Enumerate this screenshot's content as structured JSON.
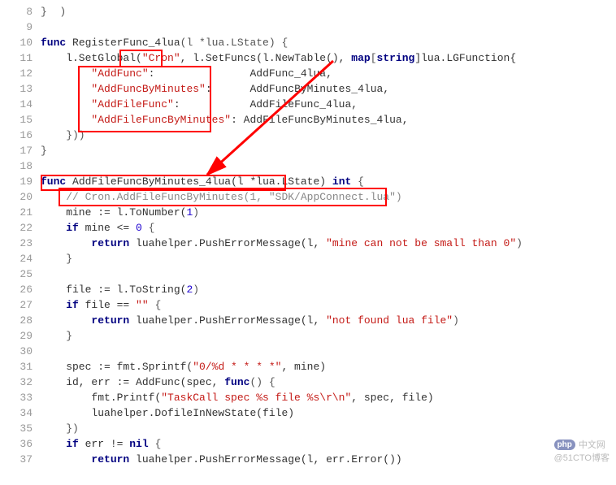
{
  "lines": [
    {
      "num": "8",
      "tokens": [
        {
          "t": "}  )",
          "c": "punct"
        }
      ]
    },
    {
      "num": "9",
      "tokens": []
    },
    {
      "num": "10",
      "tokens": [
        {
          "t": "func ",
          "c": "kw"
        },
        {
          "t": "RegisterFunc_4lua",
          "c": "func"
        },
        {
          "t": "(l *lua.LState) {",
          "c": "punct"
        }
      ]
    },
    {
      "num": "11",
      "tokens": [
        {
          "t": "    l.SetGlobal(",
          "c": "ident"
        },
        {
          "t": "\"Cron\"",
          "c": "str"
        },
        {
          "t": ", l.SetFuncs(l.NewTable(), ",
          "c": "ident"
        },
        {
          "t": "map",
          "c": "kw"
        },
        {
          "t": "[",
          "c": "punct"
        },
        {
          "t": "string",
          "c": "kw"
        },
        {
          "t": "]lua.LGFunction{",
          "c": "ident"
        }
      ]
    },
    {
      "num": "12",
      "tokens": [
        {
          "t": "        ",
          "c": ""
        },
        {
          "t": "\"AddFunc\"",
          "c": "str"
        },
        {
          "t": ":               AddFunc_4lua,",
          "c": "ident"
        }
      ]
    },
    {
      "num": "13",
      "tokens": [
        {
          "t": "        ",
          "c": ""
        },
        {
          "t": "\"AddFuncByMinutes\"",
          "c": "str"
        },
        {
          "t": ":      AddFuncByMinutes_4lua,",
          "c": "ident"
        }
      ]
    },
    {
      "num": "14",
      "tokens": [
        {
          "t": "        ",
          "c": ""
        },
        {
          "t": "\"AddFileFunc\"",
          "c": "str"
        },
        {
          "t": ":           AddFileFunc_4lua,",
          "c": "ident"
        }
      ]
    },
    {
      "num": "15",
      "tokens": [
        {
          "t": "        ",
          "c": ""
        },
        {
          "t": "\"AddFileFuncByMinutes\"",
          "c": "str"
        },
        {
          "t": ": AddFileFuncByMinutes_4lua,",
          "c": "ident"
        }
      ]
    },
    {
      "num": "16",
      "tokens": [
        {
          "t": "    }))",
          "c": "punct"
        }
      ]
    },
    {
      "num": "17",
      "tokens": [
        {
          "t": "}",
          "c": "punct"
        }
      ]
    },
    {
      "num": "18",
      "tokens": []
    },
    {
      "num": "19",
      "tokens": [
        {
          "t": "func ",
          "c": "kw"
        },
        {
          "t": "AddFileFuncByMinutes_4lua",
          "c": "func"
        },
        {
          "t": "(l *lua.LState) ",
          "c": "ident"
        },
        {
          "t": "int",
          "c": "kw"
        },
        {
          "t": " {",
          "c": "punct"
        }
      ]
    },
    {
      "num": "20",
      "tokens": [
        {
          "t": "    // Cron.AddFileFuncByMinutes(1, \"SDK/AppConnect.lua\")",
          "c": "comment"
        }
      ]
    },
    {
      "num": "21",
      "tokens": [
        {
          "t": "    mine := l.ToNumber(",
          "c": "ident"
        },
        {
          "t": "1",
          "c": "num"
        },
        {
          "t": ")",
          "c": "punct"
        }
      ]
    },
    {
      "num": "22",
      "tokens": [
        {
          "t": "    ",
          "c": ""
        },
        {
          "t": "if",
          "c": "kw"
        },
        {
          "t": " mine <= ",
          "c": "ident"
        },
        {
          "t": "0",
          "c": "num"
        },
        {
          "t": " {",
          "c": "punct"
        }
      ]
    },
    {
      "num": "23",
      "tokens": [
        {
          "t": "        ",
          "c": ""
        },
        {
          "t": "return",
          "c": "kw"
        },
        {
          "t": " luahelper.PushErrorMessage(l, ",
          "c": "ident"
        },
        {
          "t": "\"mine can not be small than 0\"",
          "c": "str"
        },
        {
          "t": ")",
          "c": "punct"
        }
      ]
    },
    {
      "num": "24",
      "tokens": [
        {
          "t": "    }",
          "c": "punct"
        }
      ]
    },
    {
      "num": "25",
      "tokens": []
    },
    {
      "num": "26",
      "tokens": [
        {
          "t": "    file := l.ToString(",
          "c": "ident"
        },
        {
          "t": "2",
          "c": "num"
        },
        {
          "t": ")",
          "c": "punct"
        }
      ]
    },
    {
      "num": "27",
      "tokens": [
        {
          "t": "    ",
          "c": ""
        },
        {
          "t": "if",
          "c": "kw"
        },
        {
          "t": " file == ",
          "c": "ident"
        },
        {
          "t": "\"\"",
          "c": "str"
        },
        {
          "t": " {",
          "c": "punct"
        }
      ]
    },
    {
      "num": "28",
      "tokens": [
        {
          "t": "        ",
          "c": ""
        },
        {
          "t": "return",
          "c": "kw"
        },
        {
          "t": " luahelper.PushErrorMessage(l, ",
          "c": "ident"
        },
        {
          "t": "\"not found lua file\"",
          "c": "str"
        },
        {
          "t": ")",
          "c": "punct"
        }
      ]
    },
    {
      "num": "29",
      "tokens": [
        {
          "t": "    }",
          "c": "punct"
        }
      ]
    },
    {
      "num": "30",
      "tokens": []
    },
    {
      "num": "31",
      "tokens": [
        {
          "t": "    spec := fmt.Sprintf(",
          "c": "ident"
        },
        {
          "t": "\"0/%d * * * *\"",
          "c": "str"
        },
        {
          "t": ", mine)",
          "c": "ident"
        }
      ]
    },
    {
      "num": "32",
      "tokens": [
        {
          "t": "    id, err := AddFunc(spec, ",
          "c": "ident"
        },
        {
          "t": "func",
          "c": "kw"
        },
        {
          "t": "() {",
          "c": "punct"
        }
      ]
    },
    {
      "num": "33",
      "tokens": [
        {
          "t": "        fmt.Printf(",
          "c": "ident"
        },
        {
          "t": "\"TaskCall spec %s file %s\\r\\n\"",
          "c": "str"
        },
        {
          "t": ", spec, file)",
          "c": "ident"
        }
      ]
    },
    {
      "num": "34",
      "tokens": [
        {
          "t": "        luahelper.DofileInNewState(file)",
          "c": "ident"
        }
      ]
    },
    {
      "num": "35",
      "tokens": [
        {
          "t": "    })",
          "c": "punct"
        }
      ]
    },
    {
      "num": "36",
      "tokens": [
        {
          "t": "    ",
          "c": ""
        },
        {
          "t": "if",
          "c": "kw"
        },
        {
          "t": " err != ",
          "c": "ident"
        },
        {
          "t": "nil",
          "c": "kw"
        },
        {
          "t": " {",
          "c": "punct"
        }
      ]
    },
    {
      "num": "37",
      "tokens": [
        {
          "t": "        ",
          "c": ""
        },
        {
          "t": "return",
          "c": "kw"
        },
        {
          "t": " luahelper.PushErrorMessage(l, err.Error())",
          "c": "ident"
        }
      ]
    }
  ],
  "watermark": {
    "line1": "中文网",
    "line2": "@51CTO博客"
  }
}
